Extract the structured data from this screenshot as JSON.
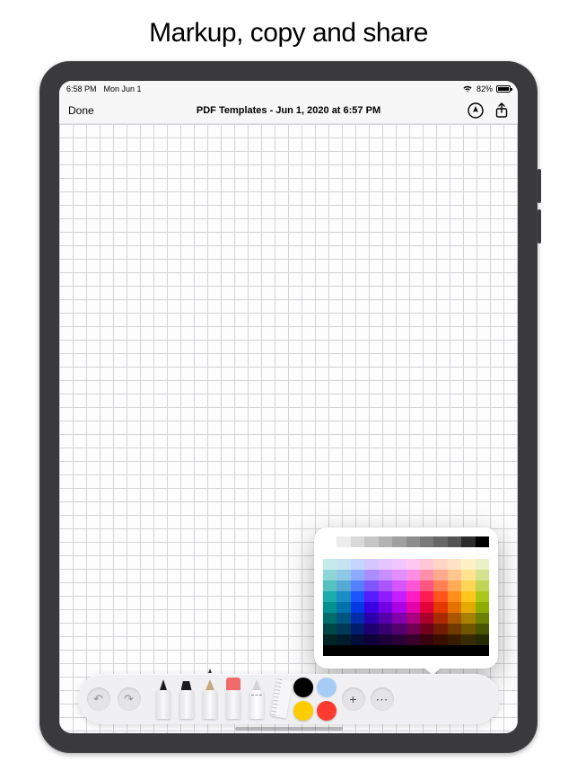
{
  "headline": "Markup, copy and share",
  "status_bar": {
    "time": "6:58 PM",
    "date": "Mon Jun 1",
    "battery_pct": "82%"
  },
  "nav": {
    "done": "Done",
    "title": "PDF Templates - Jun 1, 2020 at 6:57 PM",
    "markup_icon": "markup-icon",
    "share_icon": "share-icon"
  },
  "tools": {
    "undo": "↶",
    "redo": "↷",
    "list": [
      "pen",
      "marker",
      "pencil",
      "eraser",
      "lasso",
      "ruler"
    ],
    "add": "+",
    "more": "⋯"
  },
  "swatches": {
    "black": "#000000",
    "blue": "#007aff",
    "green": "#28c840",
    "yellow": "#ffcc00",
    "red": "#ff3b30"
  },
  "color_popover": {
    "grays": [
      "#ffffff",
      "#ececec",
      "#d9d9d9",
      "#c6c6c6",
      "#b3b3b3",
      "#a0a0a0",
      "#8d8d8d",
      "#7a7a7a",
      "#676767",
      "#545454",
      "#2b2b2b",
      "#000000"
    ],
    "hues": [
      "#00a2a2",
      "#0080c0",
      "#0040ff",
      "#4000ff",
      "#8000ff",
      "#c000ff",
      "#ff00c0",
      "#ff0040",
      "#ff4000",
      "#ff8000",
      "#ffc000",
      "#a0c000"
    ]
  }
}
